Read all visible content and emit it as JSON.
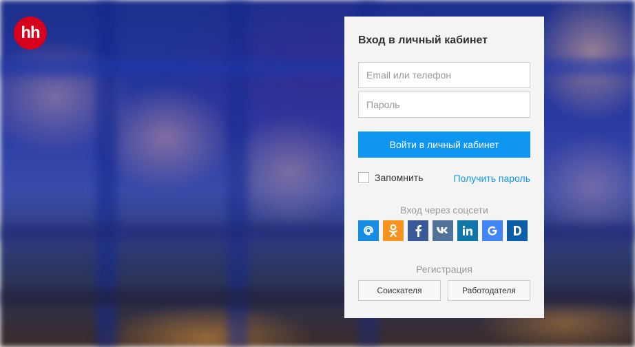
{
  "logo": {
    "text": "hh",
    "color": "#d6001c"
  },
  "login": {
    "title": "Вход в личный кабинет",
    "email_placeholder": "Email или телефон",
    "email_value": "",
    "password_placeholder": "Пароль",
    "password_value": "",
    "submit_label": "Войти в личный кабинет",
    "remember_label": "Запомнить",
    "remember_checked": false,
    "get_password_label": "Получить пароль",
    "accent_color": "#0f96f0"
  },
  "social": {
    "label": "Вход через соцсети",
    "providers": [
      {
        "name": "mail-ru",
        "glyph": "@",
        "color": "#168de2"
      },
      {
        "name": "odnoklassniki",
        "glyph": "ок",
        "color": "#f7931e"
      },
      {
        "name": "facebook",
        "glyph": "f",
        "color": "#3b5998"
      },
      {
        "name": "vkontakte",
        "glyph": "vk",
        "color": "#507299"
      },
      {
        "name": "linkedin",
        "glyph": "in",
        "color": "#0e76a8"
      },
      {
        "name": "google",
        "glyph": "G",
        "color": "#4285f4"
      },
      {
        "name": "d-service",
        "glyph": "D",
        "color": "#0b5ea8"
      }
    ]
  },
  "registration": {
    "label": "Регистрация",
    "seeker_label": "Соискателя",
    "employer_label": "Работодателя"
  }
}
